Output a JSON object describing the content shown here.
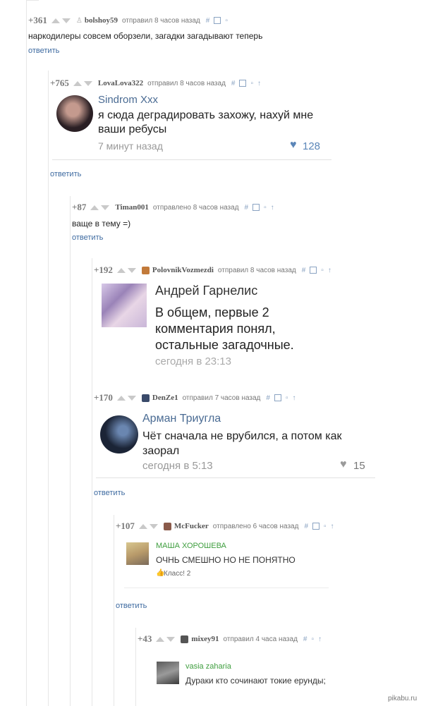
{
  "comments": [
    {
      "score": "+361",
      "user": "bolshoy59",
      "when": "отправил 8 часов назад",
      "text": "наркодилеры совсем оборзели, загадки загадывают теперь",
      "reply": "ответить"
    },
    {
      "score": "+765",
      "user": "LovaLova322",
      "when": "отправил 8 часов назад",
      "reply": "ответить",
      "screenshot": {
        "name": "Sindrom Xxx",
        "text": "я сюда деградировать захожу, нахуй мне ваши ребусы",
        "time": "7 минут назад",
        "likes": "128"
      }
    },
    {
      "score": "+87",
      "user": "Timan001",
      "when": "отправлено 8 часов назад",
      "text": "ваще в тему =)",
      "reply": "ответить"
    },
    {
      "score": "+192",
      "user": "PolovnikVozmezdi",
      "when": "отправил 8 часов назад",
      "screenshot": {
        "name": "Андрей Гарнелис",
        "text": "В общем, первые 2 комментария понял, остальные загадочные.",
        "time": "сегодня в 23:13"
      }
    },
    {
      "score": "+170",
      "user": "DenZe1",
      "when": "отправил 7 часов назад",
      "reply": "ответить",
      "screenshot": {
        "name": "Арман Триугла",
        "text": "Чёт сначала не врубился, а потом как заорал",
        "time": "сегодня в 5:13",
        "likes": "15"
      }
    },
    {
      "score": "+107",
      "user": "McFucker",
      "when": "отправлено 6 часов назад",
      "reply": "ответить",
      "screenshot": {
        "name": "МАША ХОРОШЕВА",
        "text": "ОЧНЬ СМЕШНО НО НЕ ПОНЯТНО",
        "likes": "Класс! 2"
      }
    },
    {
      "score": "+43",
      "user": "mixey91",
      "when": "отправил 4 часа назад",
      "screenshot": {
        "name": "vasia zaharia",
        "text": "Дураки кто сочинают токие ерунды;"
      }
    }
  ],
  "watermark": "pikabu.ru",
  "colors": {
    "link": "#3d6aa0",
    "score": "#7a7a7a",
    "vk_name": "#4a6b93",
    "ok_green": "#3f9e3f",
    "heart": "#5b86b8"
  }
}
